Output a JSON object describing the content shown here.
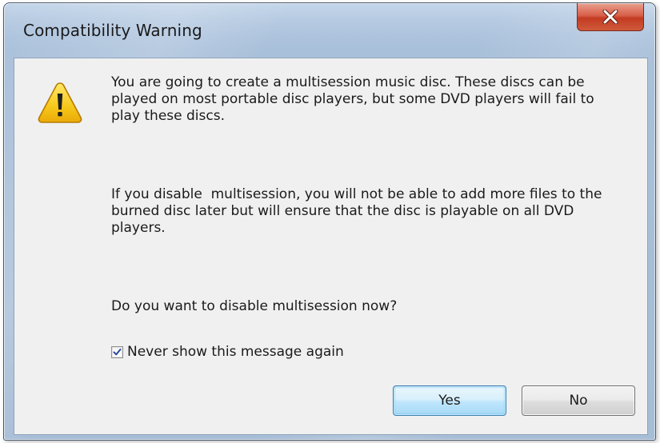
{
  "dialog": {
    "title": "Compatibility Warning",
    "close_icon": "close-icon",
    "warning_icon": "warning-icon",
    "message_1": "You are going to create a multisession music disc. These discs can be played on most portable disc players, but some DVD players will fail to play these discs.",
    "message_2": "If you disable  multisession, you will not be able to add more files to the burned disc later but will ensure that the disc is playable on all DVD players.",
    "message_3": "Do you want to disable multisession now?",
    "checkbox_label": "Never show this message again",
    "checkbox_checked": true,
    "yes_label": "Yes",
    "no_label": "No"
  },
  "colors": {
    "close_button": "#c94a32",
    "default_button_border": "#3c7fb1",
    "window_frame": "#aec4de",
    "client_background": "#f0f0f0"
  }
}
